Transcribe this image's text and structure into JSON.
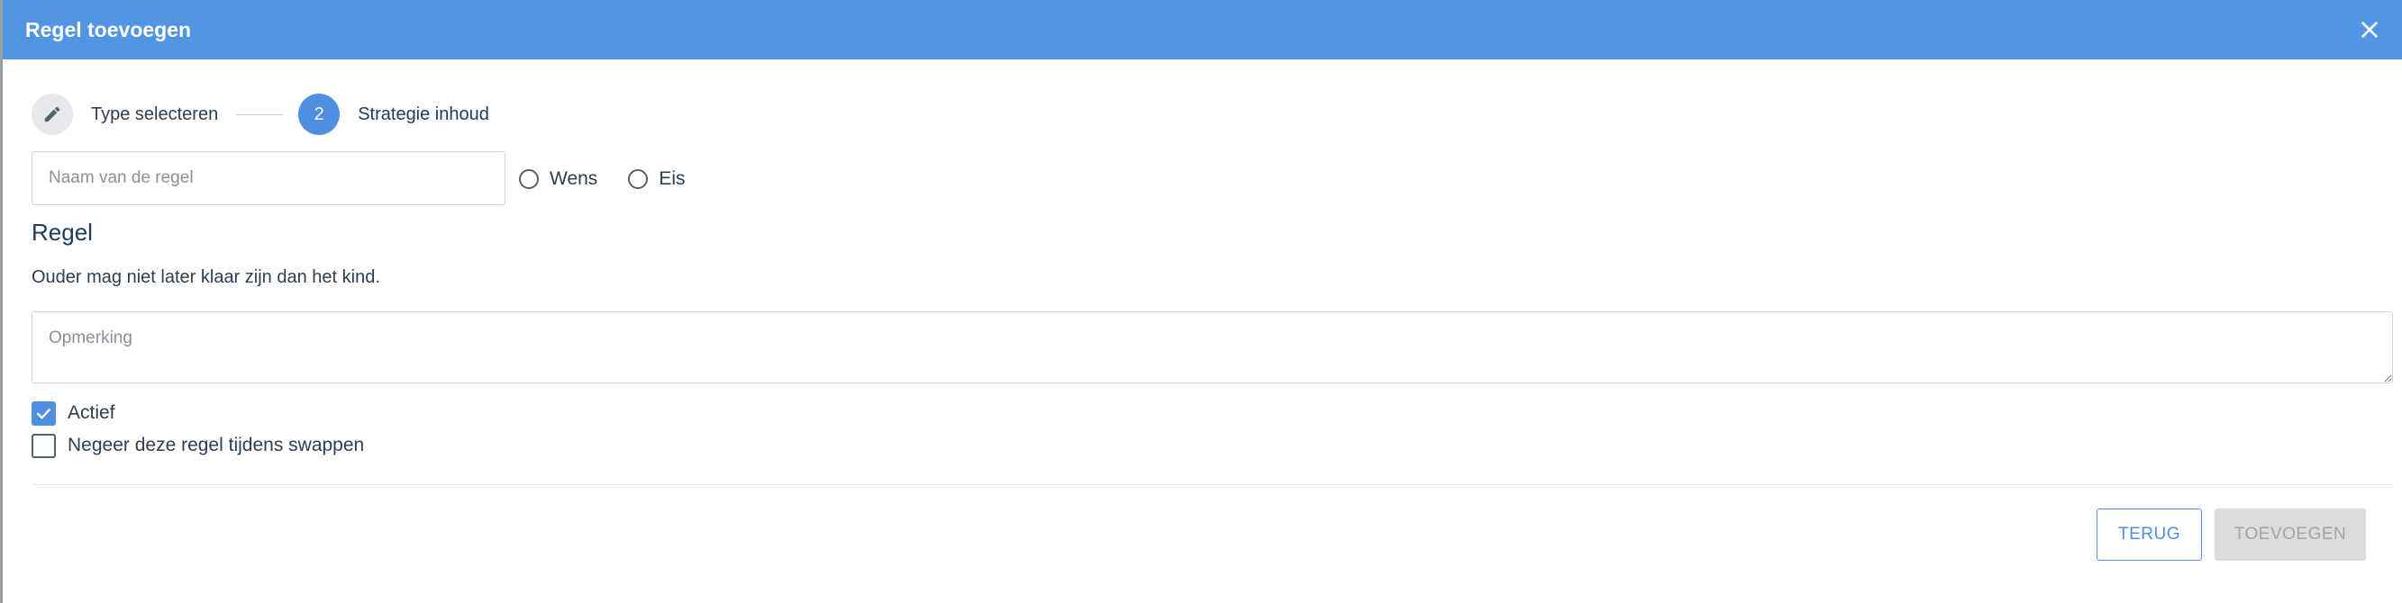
{
  "dialog": {
    "title": "Regel toevoegen",
    "close_icon": "close-icon"
  },
  "stepper": {
    "steps": [
      {
        "label": "Type selecteren",
        "state": "done",
        "icon": "pencil-icon"
      },
      {
        "label": "Strategie inhoud",
        "state": "active",
        "number": "2"
      }
    ]
  },
  "form": {
    "name_placeholder": "Naam van de regel",
    "name_value": "",
    "radio_options": [
      {
        "label": "Wens",
        "selected": false
      },
      {
        "label": "Eis",
        "selected": false
      }
    ],
    "section_title": "Regel",
    "rule_description": "Ouder mag niet later klaar zijn dan het kind.",
    "remark_placeholder": "Opmerking",
    "remark_value": "",
    "checkboxes": [
      {
        "label": "Actief",
        "checked": true
      },
      {
        "label": "Negeer deze regel tijdens swappen",
        "checked": false
      }
    ]
  },
  "footer": {
    "back_label": "TERUG",
    "add_label": "TOEVOEGEN"
  },
  "colors": {
    "header": "#5295e2",
    "accent": "#4f8fe0",
    "disabled_bg": "#dcdcdc",
    "disabled_text": "#a3a3a3"
  }
}
